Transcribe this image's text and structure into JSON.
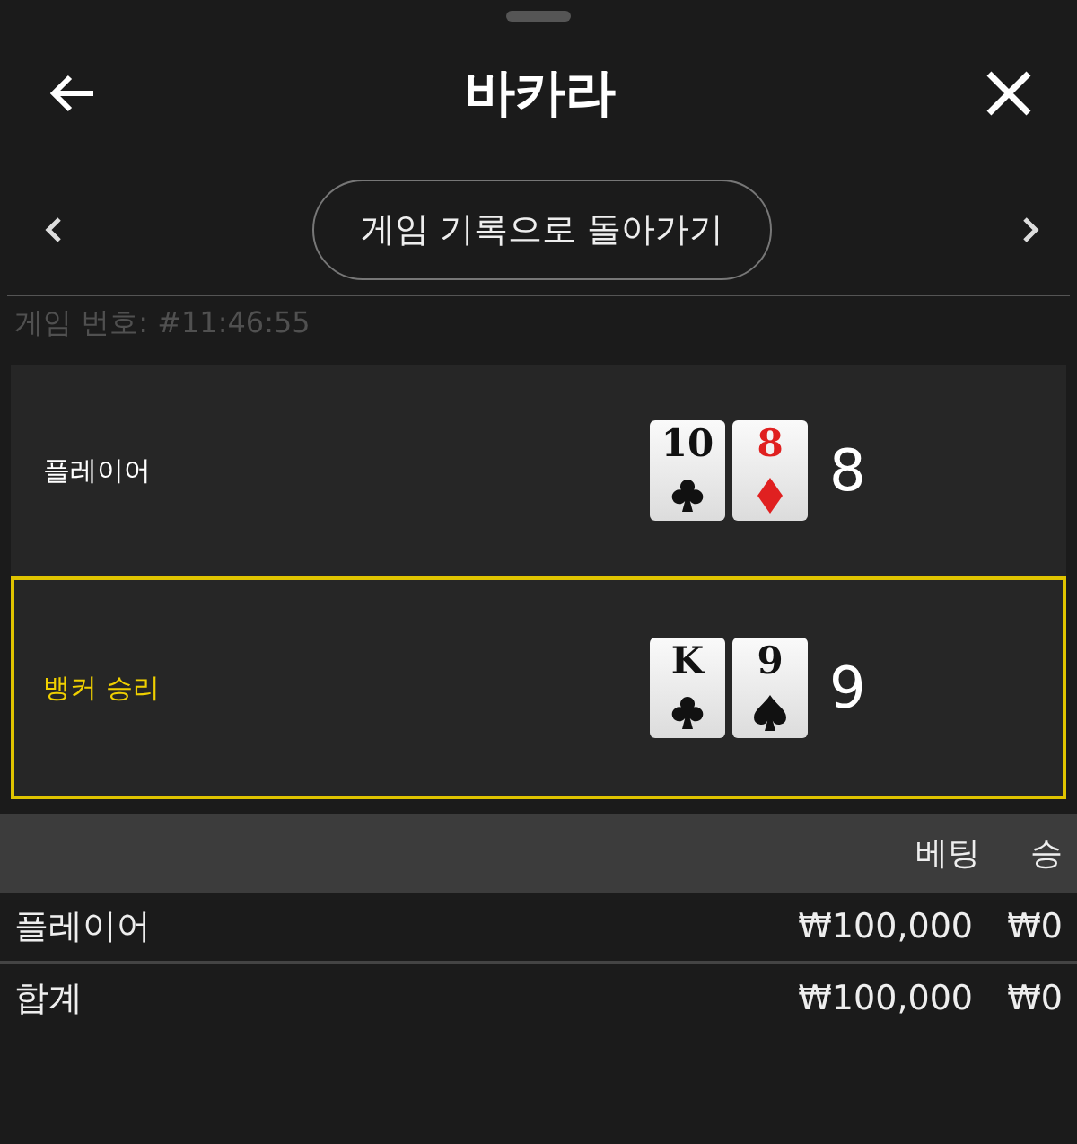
{
  "title": "바카라",
  "history_button": {
    "label": "게임 기록으로 돌아가기"
  },
  "game_number": "게임 번호: #11:46:55",
  "hands": [
    {
      "label": "플레이어",
      "winner": false,
      "cards": [
        {
          "rank": "10",
          "kind": "clubs"
        },
        {
          "rank": "8",
          "kind": "diamonds"
        }
      ],
      "total": "8"
    },
    {
      "label": "뱅커 승리",
      "winner": true,
      "cards": [
        {
          "rank": "K",
          "kind": "clubs"
        },
        {
          "rank": "9",
          "kind": "spades"
        }
      ],
      "total": "9"
    }
  ],
  "table": {
    "columns": [
      "베팅",
      "승"
    ],
    "rows": [
      {
        "label": "플레이어",
        "bet": "₩100,000",
        "win": "₩0"
      },
      {
        "label": "합계",
        "bet": "₩100,000",
        "win": "₩0"
      }
    ]
  }
}
